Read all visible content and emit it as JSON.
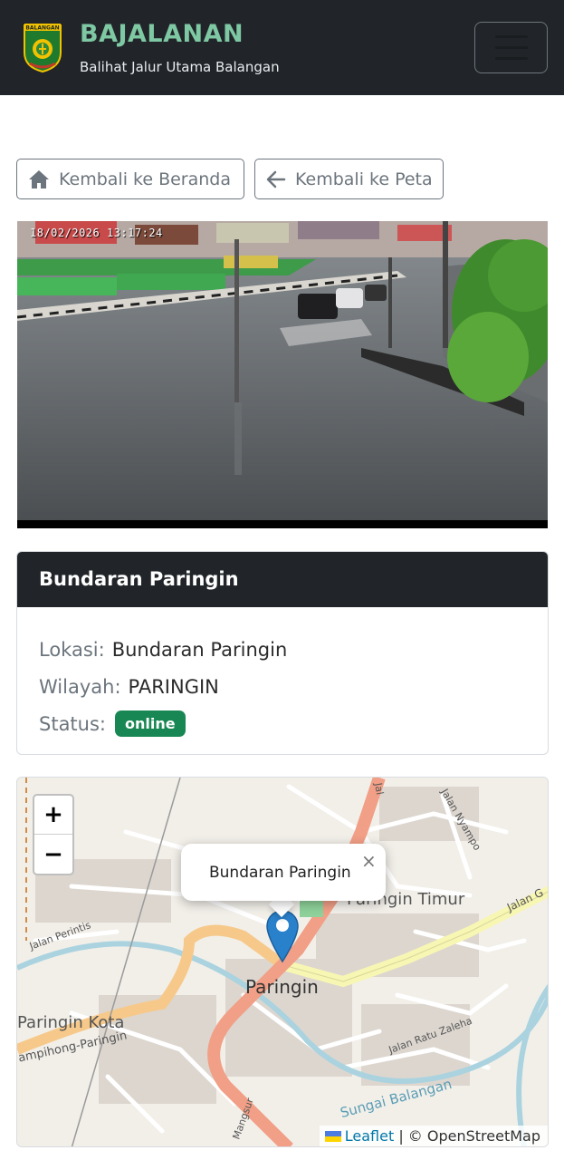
{
  "header": {
    "title": "BAJALANAN",
    "subtitle": "Balihat Jalur Utama Balangan",
    "logo_text": "BALANGAN",
    "brand_color": "#7ec8a4"
  },
  "actions": {
    "home_label": "Kembali ke Beranda",
    "back_label": "Kembali ke Peta"
  },
  "camera": {
    "timestamp": "18/02/2026 13:17:24"
  },
  "card": {
    "title": "Bundaran Paringin",
    "location_label": "Lokasi:",
    "location_value": "Bundaran Paringin",
    "region_label": "Wilayah:",
    "region_value": "PARINGIN",
    "status_label": "Status:",
    "status_value": "online",
    "status_color": "#198754"
  },
  "map": {
    "zoom_in": "+",
    "zoom_out": "−",
    "popup_text": "Bundaran Paringin",
    "popup_close": "×",
    "attribution_leaflet": "Leaflet",
    "attribution_sep": " | ",
    "attribution_osm": "© OpenStreetMap",
    "labels": {
      "paringin": "Paringin",
      "paringin_timur": "Paringin Timur",
      "paringin_kota": "Paringin Kota",
      "jalan_perintis": "Jalan Perintis",
      "jalan_nyampo": "Jalan Nyampo",
      "jalan_g": "Jalan G",
      "jalan_ratu_zaleha": "Jalan Ratu Zaleha",
      "sungai_balangan": "Sungai Balangan",
      "ampihong": "ampihong-Paringin",
      "mangsur": "Mangsur",
      "jal": "Jal"
    }
  }
}
